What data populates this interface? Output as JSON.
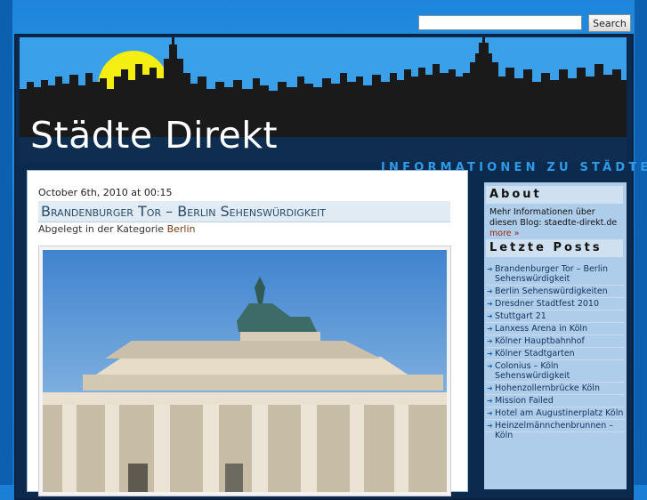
{
  "search": {
    "placeholder": "",
    "button_label": "Search"
  },
  "header": {
    "title": "Städte Direkt",
    "tagline": "INFORMATIONEN ZU STÄDTE"
  },
  "post": {
    "date": "October 6th, 2010 at 00:15",
    "title": "Brandenburger Tor – Berlin Sehenswürdigkeit",
    "category_prefix": "Abgelegt in der Kategorie",
    "category_link": "Berlin"
  },
  "sidebar": {
    "about_heading": "About",
    "about_text": "Mehr Informationen über diesen Blog: staedte-direkt.de",
    "about_more": "more »",
    "posts_heading": "Letzte Posts",
    "posts": [
      "Brandenburger Tor – Berlin Sehenswürdigkeit",
      "Berlin Sehenswürdigkeiten",
      "Dresdner Stadtfest 2010",
      "Stuttgart 21",
      "Lanxess Arena in Köln",
      "Kölner Hauptbahnhof",
      "Kölner Stadtgarten",
      "Colonius – Köln Sehenswürdigkeit",
      "Hohenzollernbrücke Köln",
      "Mission Failed",
      "Hotel am Augustinerplatz Köln",
      "Heinzelmännchenbrunnen – Köln"
    ]
  },
  "colors": {
    "page_bg": "#1b7fd6",
    "header_sky": "#39a0ea",
    "skyline": "#1a1a1a",
    "sun": "#f5ee13",
    "category_link": "#7a3c10",
    "more_link": "#a0260e"
  },
  "icons": [
    "arrow-icon"
  ]
}
